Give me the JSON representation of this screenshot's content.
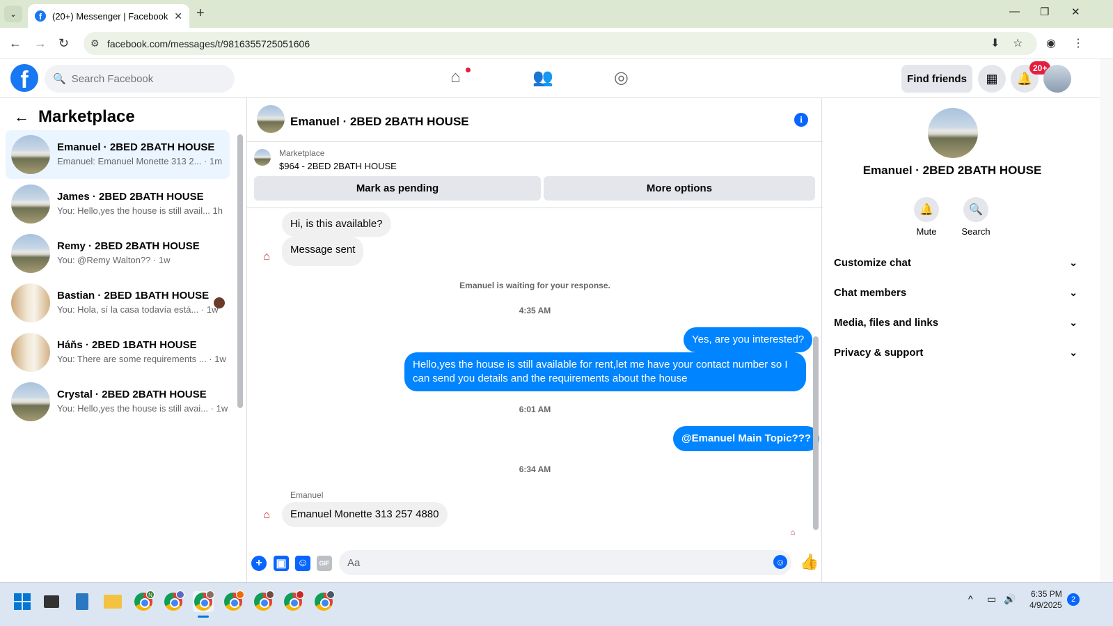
{
  "browser": {
    "tab_title": "(20+) Messenger | Facebook",
    "url": "facebook.com/messages/t/9816355725051606"
  },
  "header": {
    "search_placeholder": "Search Facebook",
    "find_friends": "Find friends",
    "notification_badge": "20+"
  },
  "sidebar": {
    "title": "Marketplace",
    "conversations": [
      {
        "name": "Emanuel · 2BED 2BATH HOUSE",
        "preview": "Emanuel: Emanuel Monette 313 2...",
        "time": "· 1m",
        "thumb": "house",
        "active": true
      },
      {
        "name": "James · 2BED 2BATH HOUSE",
        "preview": "You: Hello,yes the house is still avail...",
        "time": "1h",
        "thumb": "house"
      },
      {
        "name": "Remy · 2BED 2BATH HOUSE",
        "preview": "You: @Remy Walton??",
        "time": "· 1w",
        "thumb": "house"
      },
      {
        "name": "Bastian · 2BED 1BATH HOUSE",
        "preview": "You: Hola, sí la casa todavía está...",
        "time": "· 1w",
        "thumb": "room"
      },
      {
        "name": "Háňs · 2BED 1BATH HOUSE",
        "preview": "You: There are some requirements ...",
        "time": "· 1w",
        "thumb": "room"
      },
      {
        "name": "Crystal · 2BED 2BATH HOUSE",
        "preview": "You: Hello,yes the house is still avai...",
        "time": "· 1w",
        "thumb": "house"
      }
    ]
  },
  "chat": {
    "title": "Emanuel · 2BED 2BATH HOUSE",
    "listing_source": "Marketplace",
    "listing": "$964 - 2BED 2BATH HOUSE",
    "mark_pending": "Mark as pending",
    "more_options": "More options",
    "messages": {
      "m1": "Hi, is this available?",
      "m2": "Message sent",
      "waiting": "Emanuel is waiting for your response.",
      "ts1": "4:35 AM",
      "m3": "Yes, are you interested?",
      "m4_line1": "Hello,yes the house is still available for rent,let me have your contact number   so I",
      "m4_line2": "can send you details and the requirements about the house",
      "ts2": "6:01 AM",
      "m5": "@Emanuel Main Topic???",
      "ts3": "6:34 AM",
      "sender": "Emanuel",
      "m6": "Emanuel Monette 313 257 4880"
    },
    "composer_placeholder": "Aa"
  },
  "details": {
    "title": "Emanuel · 2BED 2BATH HOUSE",
    "mute": "Mute",
    "search": "Search",
    "sections": [
      "Customize chat",
      "Chat members",
      "Media, files and links",
      "Privacy & support"
    ]
  },
  "taskbar": {
    "time": "6:35 PM",
    "date": "4/9/2025",
    "notifications": "2"
  }
}
